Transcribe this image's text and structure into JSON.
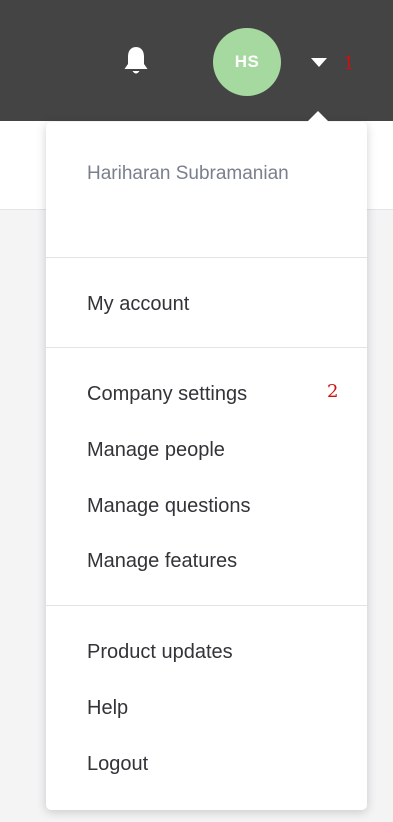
{
  "header": {
    "avatar_initials": "HS",
    "avatar_color": "#a5d9a0",
    "bell_icon": "bell-icon",
    "caret_icon": "caret-down-icon",
    "annotation": "1"
  },
  "dropdown": {
    "user_name": "Hariharan Subramanian",
    "sections": [
      {
        "items": [
          {
            "label": "My account"
          }
        ]
      },
      {
        "items": [
          {
            "label": "Company settings",
            "annotation": "2"
          },
          {
            "label": "Manage people"
          },
          {
            "label": "Manage questions"
          },
          {
            "label": "Manage features"
          }
        ]
      },
      {
        "items": [
          {
            "label": "Product updates"
          },
          {
            "label": "Help"
          },
          {
            "label": "Logout"
          }
        ]
      }
    ]
  },
  "colors": {
    "topbar": "#444444",
    "annotation": "#cc1111",
    "menu_text": "#333338",
    "user_text": "#7a7f8e"
  }
}
